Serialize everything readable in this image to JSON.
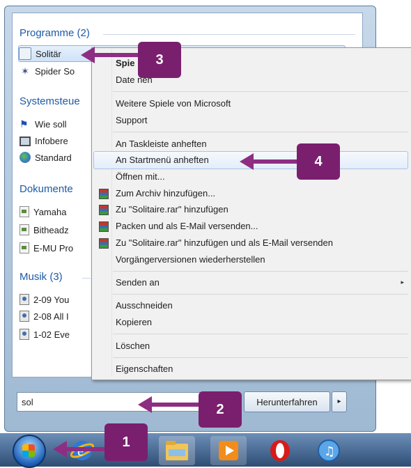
{
  "groups": {
    "programme": "Programme (2)",
    "systemsteuerung": "Systemsteue",
    "dokumente": "Dokumente",
    "musik": "Musik (3)"
  },
  "programme_items": [
    "Solitär",
    "Spider So"
  ],
  "system_items": [
    "Wie soll",
    "Infobere",
    "Standard"
  ],
  "dokument_items": [
    "Yamaha",
    "Bitheadz",
    "E-MU Pro"
  ],
  "musik_items": [
    "2-09 You",
    "2-08 All I",
    "1-02 Eve"
  ],
  "search": {
    "value": "sol"
  },
  "shutdown": {
    "label": "Herunterfahren",
    "arrow": "▸"
  },
  "context_menu": {
    "items": [
      "Spie",
      "Date          nen",
      "Weitere Spiele von Microsoft",
      "Support",
      "An Taskleiste anheften",
      "An Startmenü anheften",
      "Öffnen mit...",
      "Zum Archiv hinzufügen...",
      "Zu \"Solitaire.rar\" hinzufügen",
      "Packen und als E-Mail versenden...",
      "Zu \"Solitaire.rar\" hinzufügen und als E-Mail versenden",
      "Vorgängerversionen wiederherstellen",
      "Senden an",
      "Ausschneiden",
      "Kopieren",
      "Löschen",
      "Eigenschaften"
    ],
    "submenu_arrow": "▸"
  },
  "callouts": [
    "1",
    "2",
    "3",
    "4"
  ],
  "taskbar": {
    "icons": [
      "start-orb",
      "internet-explorer-icon",
      "windows-explorer-icon",
      "media-player-icon",
      "opera-icon",
      "itunes-icon"
    ]
  },
  "colors": {
    "callout": "#7a1f6e",
    "arrow": "#8e2e83",
    "group_heading": "#1d5aa5"
  }
}
